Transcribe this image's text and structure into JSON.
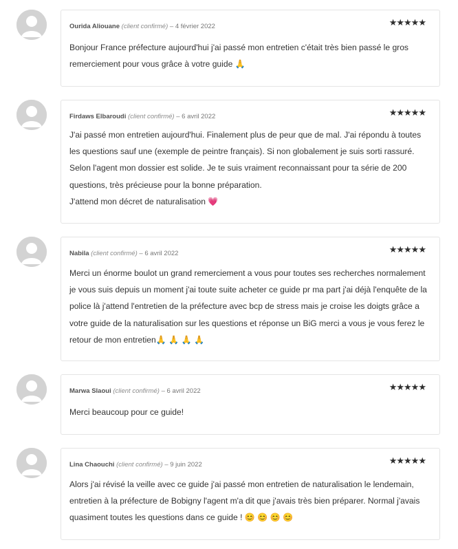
{
  "reviews": [
    {
      "author": "Ourida Aliouane",
      "verified": "(client confirmé)",
      "date": "4 février 2022",
      "rating": 5,
      "stars": "★★★★★",
      "paragraphs": [
        "Bonjour France préfecture aujourd'hui j'ai passé mon entretien c'était très bien passé le gros remerciement pour vous grâce à votre guide 🙏"
      ]
    },
    {
      "author": "Firdaws Elbaroudi",
      "verified": "(client confirmé)",
      "date": "6 avril 2022",
      "rating": 5,
      "stars": "★★★★★",
      "paragraphs": [
        "J'ai passé mon entretien aujourd'hui. Finalement plus de peur que de mal. J'ai répondu à toutes les questions sauf une (exemple de peintre français). Si non globalement je suis sorti rassuré. Selon l'agent mon dossier est solide. Je te suis vraiment reconnaissant pour ta série de 200 questions, très précieuse pour la bonne préparation.",
        "J'attend mon décret de naturalisation 💗"
      ]
    },
    {
      "author": "Nabila",
      "verified": "(client confirmé)",
      "date": "6 avril 2022",
      "rating": 5,
      "stars": "★★★★★",
      "paragraphs": [
        "Merci un énorme boulot un grand remerciement a vous pour toutes ses recherches normalement je vous suis depuis un moment j'ai toute suite acheter ce guide pr ma part j'ai déjà l'enquête de la police là j'attend l'entretien de la préfecture avec bcp de stress mais je croise les doigts grâce a votre guide de la naturalisation sur les questions et réponse un BiG merci a vous je vous ferez le retour de mon entretien🙏 🙏 🙏 🙏"
      ]
    },
    {
      "author": "Marwa Slaoui",
      "verified": "(client confirmé)",
      "date": "6 avril 2022",
      "rating": 5,
      "stars": "★★★★★",
      "paragraphs": [
        "Merci beaucoup pour ce guide!"
      ]
    },
    {
      "author": "Lina Chaouchi",
      "verified": "(client confirmé)",
      "date": "9 juin 2022",
      "rating": 5,
      "stars": "★★★★★",
      "paragraphs": [
        "Alors j'ai révisé la veille avec ce guide j'ai passé mon entretien de naturalisation le lendemain, entretien à la préfecture de Bobigny l'agent m'a dit que j'avais très bien préparer. Normal j'avais quasiment toutes les questions dans ce guide ! 😊 😊 😊 😊"
      ]
    }
  ]
}
